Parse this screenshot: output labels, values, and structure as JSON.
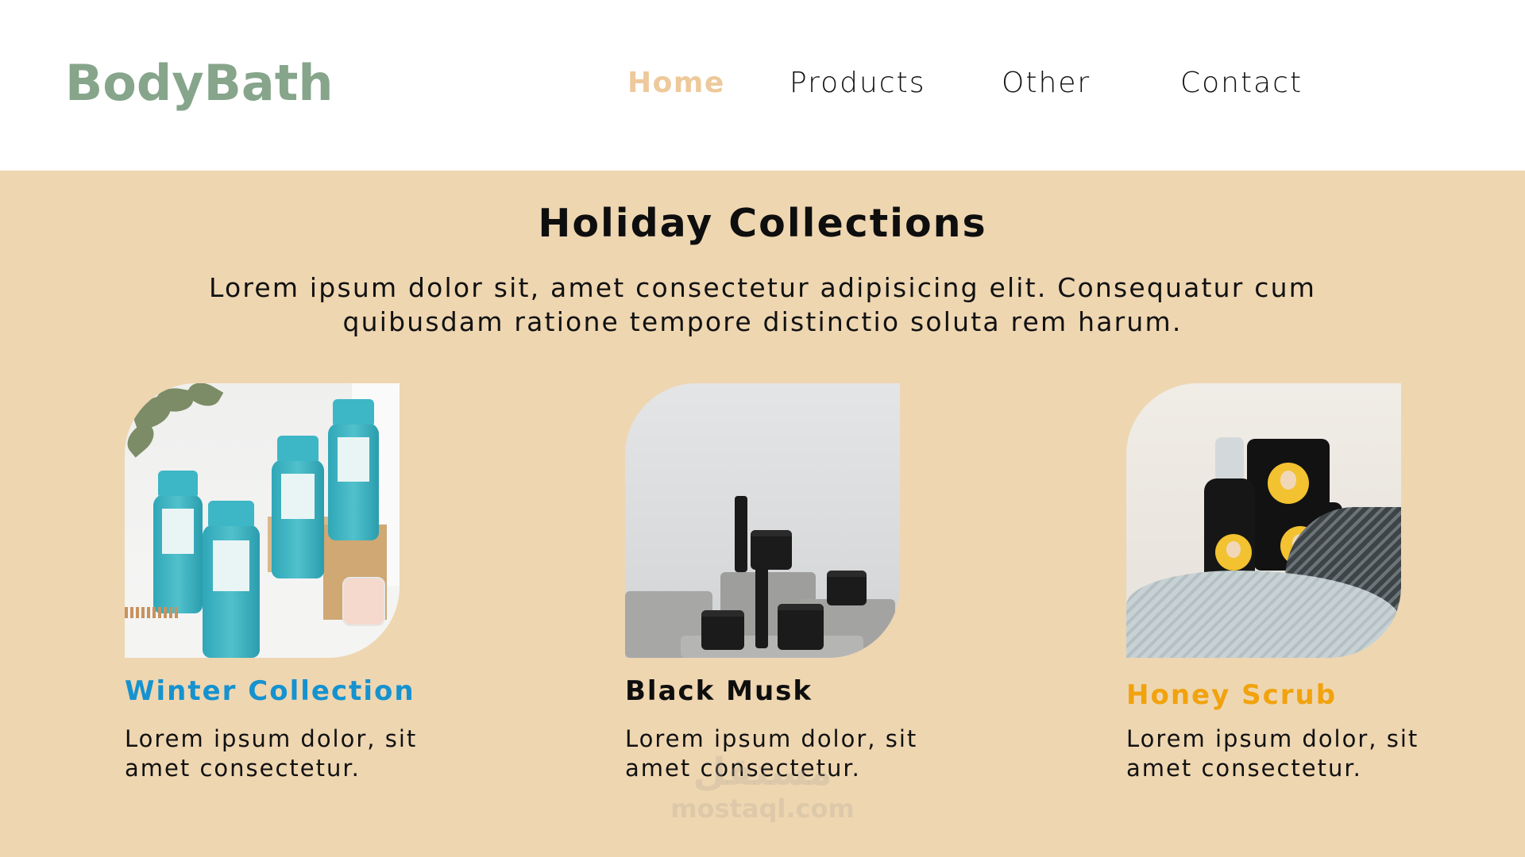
{
  "header": {
    "logo": "BodyBath",
    "nav": [
      {
        "label": "Home",
        "active": true
      },
      {
        "label": "Products",
        "active": false
      },
      {
        "label": "Other",
        "active": false
      },
      {
        "label": "Contact",
        "active": false
      }
    ]
  },
  "banner": {
    "title": "Holiday Collections",
    "subtitle_line1": "Lorem ipsum dolor sit, amet consectetur adipisicing elit. Consequatur cum",
    "subtitle_line2": "quibusdam ratione tempore distinctio soluta rem harum."
  },
  "cards": [
    {
      "title": "Winter Collection",
      "desc_line1": "Lorem ipsum dolor, sit",
      "desc_line2": "amet consectetur.",
      "title_color": "#1592CF",
      "image": "shampoo-bottles-photo"
    },
    {
      "title": "Black Musk",
      "desc_line1": "Lorem ipsum dolor, sit",
      "desc_line2": "amet consectetur.",
      "title_color": "#0E0E0E",
      "image": "black-jars-photo"
    },
    {
      "title": "Honey Scrub",
      "desc_line1": "Lorem ipsum dolor, sit",
      "desc_line2": "amet consectetur.",
      "title_color": "#F1A20D",
      "image": "honey-scrub-photo"
    }
  ],
  "colors": {
    "logo": "#86A58B",
    "nav_active": "#EDC99B",
    "banner_bg": "#EED6B1",
    "header_bg": "#FFFFFF"
  },
  "watermark": {
    "arabic": "مستقل",
    "latin": "mostaql.com"
  }
}
